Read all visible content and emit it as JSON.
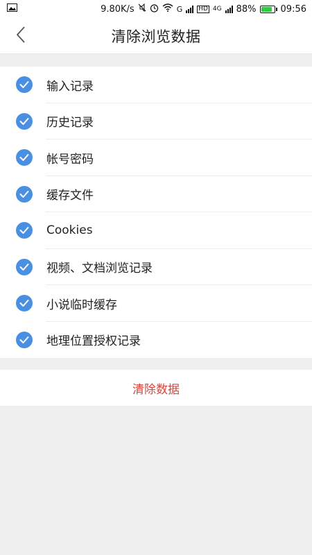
{
  "status_bar": {
    "image_icon": "image-icon",
    "speed": "9.80K/s",
    "icons": [
      "mute-icon",
      "alarm-icon",
      "wifi-icon",
      "signal-g-icon",
      "signal-hd-icon",
      "signal-4g-icon"
    ],
    "g_label": "G",
    "hd_label": "HD",
    "lte_label": "4G",
    "battery_percent": "88%",
    "battery_level": 0.88,
    "battery_color": "#2ecc40",
    "time": "09:56"
  },
  "nav": {
    "back_icon": "chevron-left-icon",
    "title": "清除浏览数据"
  },
  "options": [
    {
      "label": "输入记录",
      "checked": true
    },
    {
      "label": "历史记录",
      "checked": true
    },
    {
      "label": "帐号密码",
      "checked": true
    },
    {
      "label": "缓存文件",
      "checked": true
    },
    {
      "label": "Cookies",
      "checked": true
    },
    {
      "label": "视频、文档浏览记录",
      "checked": true
    },
    {
      "label": "小说临时缓存",
      "checked": true
    },
    {
      "label": "地理位置授权记录",
      "checked": true
    }
  ],
  "clear_button": {
    "label": "清除数据",
    "color": "#e0443b"
  },
  "colors": {
    "check_accent": "#4a90e2",
    "background": "#efefef"
  }
}
